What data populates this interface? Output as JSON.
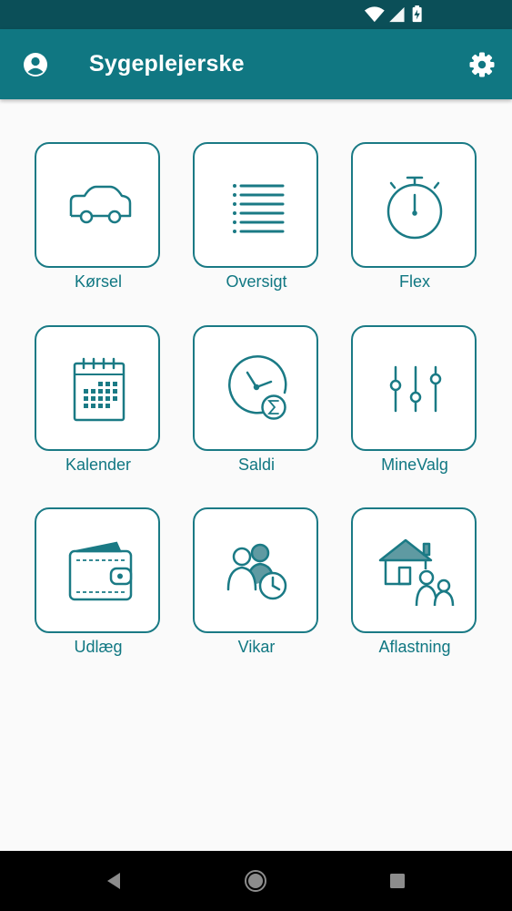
{
  "app": {
    "title": "Sygeplejerske"
  },
  "status_bar": {
    "icons": [
      "wifi-icon",
      "signal-icon",
      "battery-charging-icon"
    ]
  },
  "header": {
    "left_icon": "account-circle-icon",
    "right_icon": "settings-gear-icon"
  },
  "menu": [
    {
      "id": "korsel",
      "label": "Kørsel",
      "icon": "car-icon"
    },
    {
      "id": "oversigt",
      "label": "Oversigt",
      "icon": "list-icon"
    },
    {
      "id": "flex",
      "label": "Flex",
      "icon": "stopwatch-icon"
    },
    {
      "id": "kalender",
      "label": "Kalender",
      "icon": "calendar-icon"
    },
    {
      "id": "saldi",
      "label": "Saldi",
      "icon": "clock-sum-icon"
    },
    {
      "id": "minevalg",
      "label": "MineValg",
      "icon": "sliders-icon"
    },
    {
      "id": "udlaeg",
      "label": "Udlæg",
      "icon": "wallet-icon"
    },
    {
      "id": "vikar",
      "label": "Vikar",
      "icon": "people-clock-icon"
    },
    {
      "id": "aflastning",
      "label": "Aflastning",
      "icon": "house-family-icon"
    }
  ],
  "nav_bar": {
    "buttons": [
      "back-icon",
      "home-icon",
      "recents-icon"
    ]
  },
  "colors": {
    "primary": "#107782",
    "status_bar": "#0b4f58",
    "tile_border": "#1a7a85",
    "background": "#fafafa"
  }
}
